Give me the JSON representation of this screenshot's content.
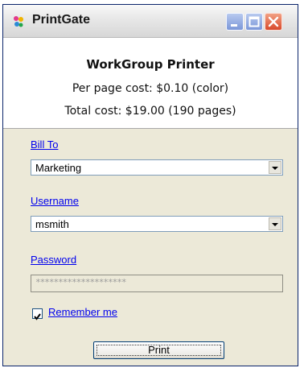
{
  "window": {
    "title": "PrintGate"
  },
  "header": {
    "printer_name": "WorkGroup Printer",
    "per_page_cost": "Per page cost: $0.10   (color)",
    "total_cost": "Total cost: $19.00  (190 pages)"
  },
  "form": {
    "bill_to_label": "Bill To",
    "bill_to_value": "Marketing",
    "username_label": "Username",
    "username_value": "msmith",
    "password_label": "Password",
    "password_value": "********************",
    "remember_label": "Remember me",
    "remember_checked": true
  },
  "actions": {
    "print_label": "Print"
  },
  "colors": {
    "link": "#0000ee",
    "window_face": "#ece9d8",
    "close_button": "#d8492b",
    "title_button": "#7b97d8"
  },
  "icons": [
    "app-icon",
    "minimize-icon",
    "maximize-icon",
    "close-icon",
    "chevron-down-icon",
    "checkmark-icon"
  ]
}
